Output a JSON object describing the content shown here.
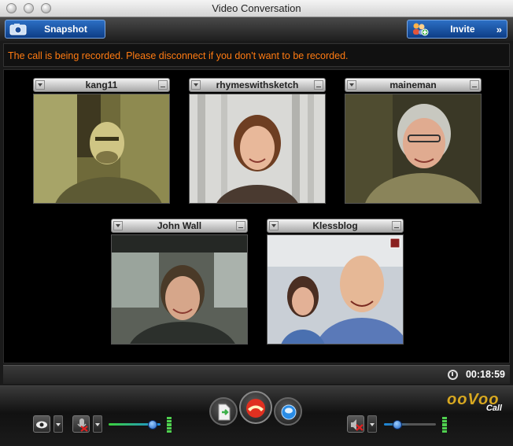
{
  "window": {
    "title": "Video Conversation"
  },
  "toolbar": {
    "snapshot_label": "Snapshot",
    "invite_label": "Invite"
  },
  "notice": {
    "text": "The call is being recorded. Please disconnect if you don't want to be recorded."
  },
  "participants": [
    {
      "name": "kang11"
    },
    {
      "name": "rhymeswithsketch"
    },
    {
      "name": "maineman"
    },
    {
      "name": "John Wall"
    },
    {
      "name": "Klessblog"
    }
  ],
  "call": {
    "elapsed": "00:18:59"
  },
  "brand": {
    "logo": "ooVoo",
    "sub": "Call"
  },
  "colors": {
    "notice": "#ff7b12",
    "accent_blue": "#1a5fc4",
    "meter_green": "#4fd14f"
  },
  "icons": [
    "camera-icon",
    "invite-icon",
    "clock-icon",
    "eye-icon",
    "mic-muted-icon",
    "speaker-muted-icon",
    "send-file-icon",
    "hangup-icon",
    "chat-icon"
  ],
  "audio": {
    "mic_volume": 0.85,
    "speaker_volume": 0.25
  }
}
